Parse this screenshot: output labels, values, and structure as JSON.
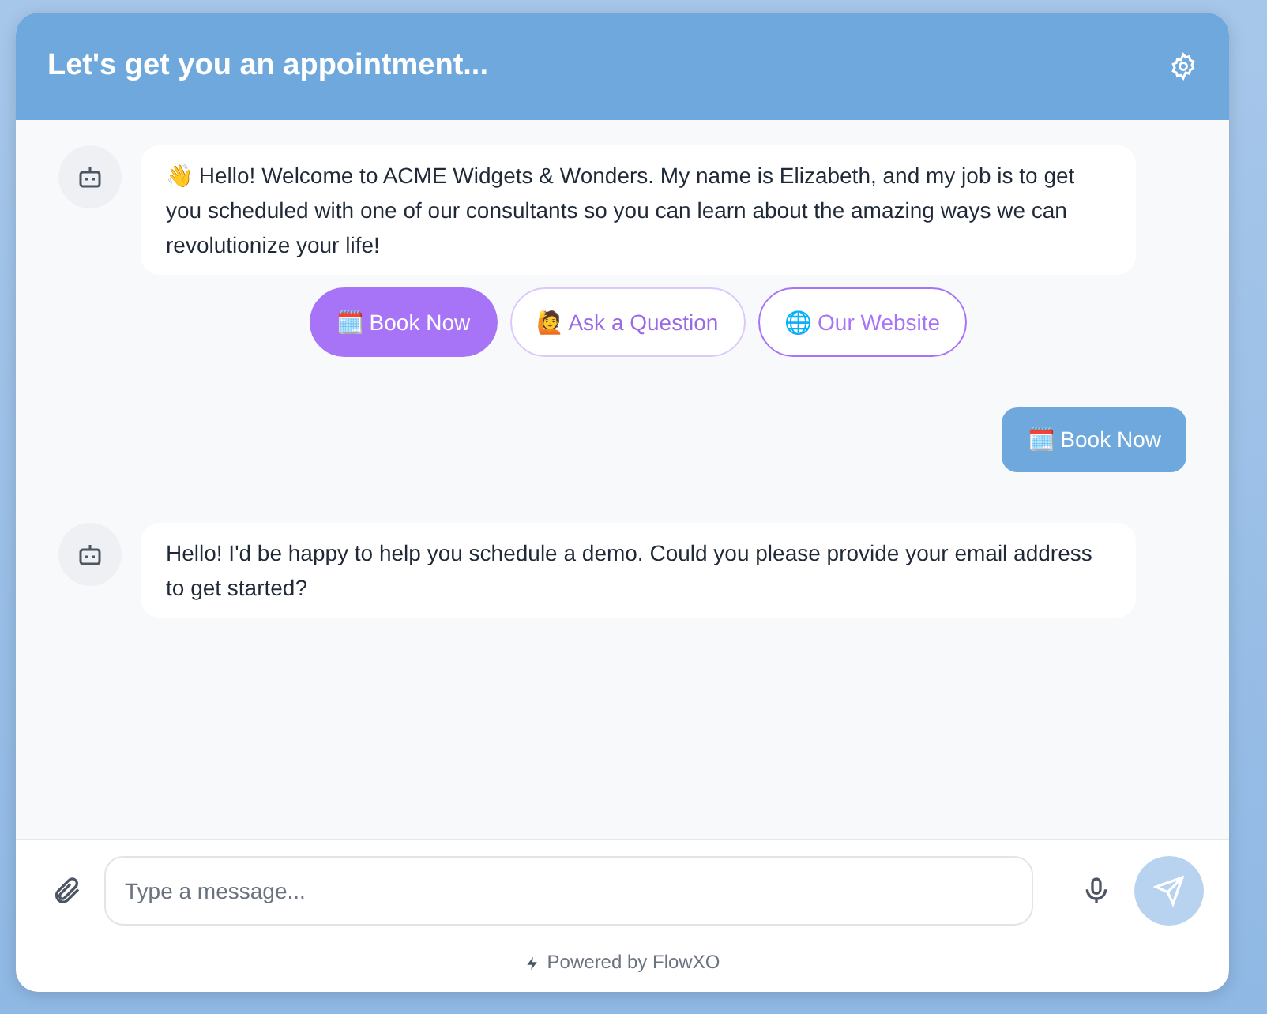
{
  "header": {
    "title": "Let's get you an appointment..."
  },
  "messages": [
    {
      "kind": "bot",
      "text": "👋 Hello! Welcome to ACME Widgets & Wonders. My name is Elizabeth, and my job is to get you scheduled with one of our consultants so you can learn about the amazing ways we can revolutionize your life!",
      "quick_replies": [
        {
          "label": "🗓️ Book Now",
          "kind": "filled",
          "disabled": false
        },
        {
          "label": "🙋 Ask a Question",
          "kind": "outline",
          "disabled": true
        },
        {
          "label": "🌐 Our Website",
          "kind": "outline",
          "disabled": false
        }
      ]
    },
    {
      "kind": "user",
      "text": "🗓️ Book Now"
    },
    {
      "kind": "bot",
      "text": "Hello! I'd be happy to help you schedule a demo. Could you please provide your email address to get started?"
    }
  ],
  "composer": {
    "placeholder": "Type a message..."
  },
  "footer": {
    "text": "Powered by FlowXO"
  }
}
